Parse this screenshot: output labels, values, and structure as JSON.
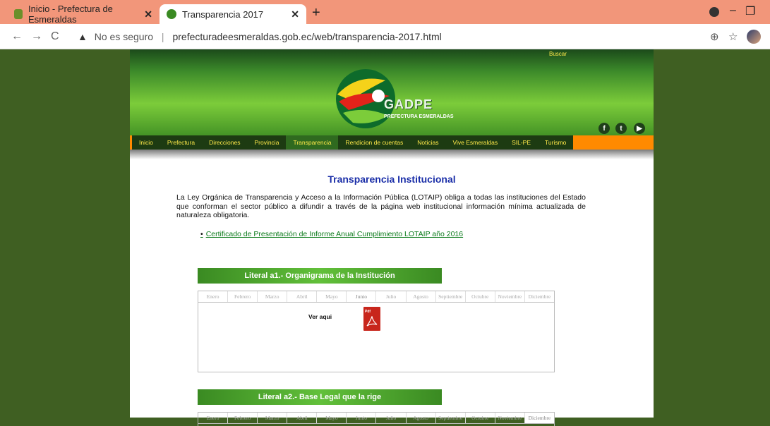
{
  "browser": {
    "tabs": [
      {
        "title": "Inicio - Prefectura de Esmeraldas",
        "active": false
      },
      {
        "title": "Transparencia 2017",
        "active": true
      }
    ],
    "security_label": "No es seguro",
    "url": "prefecturadeesmeraldas.gob.ec/web/transparencia-2017.html",
    "icons": [
      "back-icon",
      "forward-icon",
      "reload-icon",
      "warning-icon",
      "zoom-icon",
      "star-icon"
    ]
  },
  "site": {
    "search_label": "Buscar",
    "logo_text": "GADPE",
    "logo_subtext": "PREFECTURA ESMERALDAS",
    "social": [
      "f",
      "t",
      "yt"
    ],
    "menu": [
      "Inicio",
      "Prefectura",
      "Direcciones",
      "Provincia",
      "Transparencia",
      "Rendicion de cuentas",
      "Noticias",
      "Vive Esmeraldas",
      "SIL-PE",
      "Turismo"
    ],
    "active_menu": "Transparencia"
  },
  "content": {
    "title": "Transparencia Institucional",
    "intro": "La Ley Orgánica de Transparencia y Acceso a la Información Pública (LOTAIP) obliga a todas las instituciones del Estado que conforman el sector público a difundir a través de la página web institucional información mínima actualizada de naturaleza obligatoria.",
    "cert_link": "Certificado de Presentación de Informe Anual Cumplimiento LOTAIP año 2016",
    "months": [
      "Enero",
      "Febrero",
      "Marzo",
      "Abril",
      "Mayo",
      "Junio",
      "Julio",
      "Agosto",
      "Septiembre",
      "Octubre",
      "Noviembre",
      "Diciembre"
    ],
    "literals": [
      {
        "title": "Literal a1.- Organigrama de la Institución",
        "selected_month": "Junio",
        "view_label": "Ver aqui",
        "pdf_tag": "Pdf"
      },
      {
        "title": "Literal a2.- Base Legal que la rige",
        "selected_month": "Diciembre"
      }
    ]
  }
}
